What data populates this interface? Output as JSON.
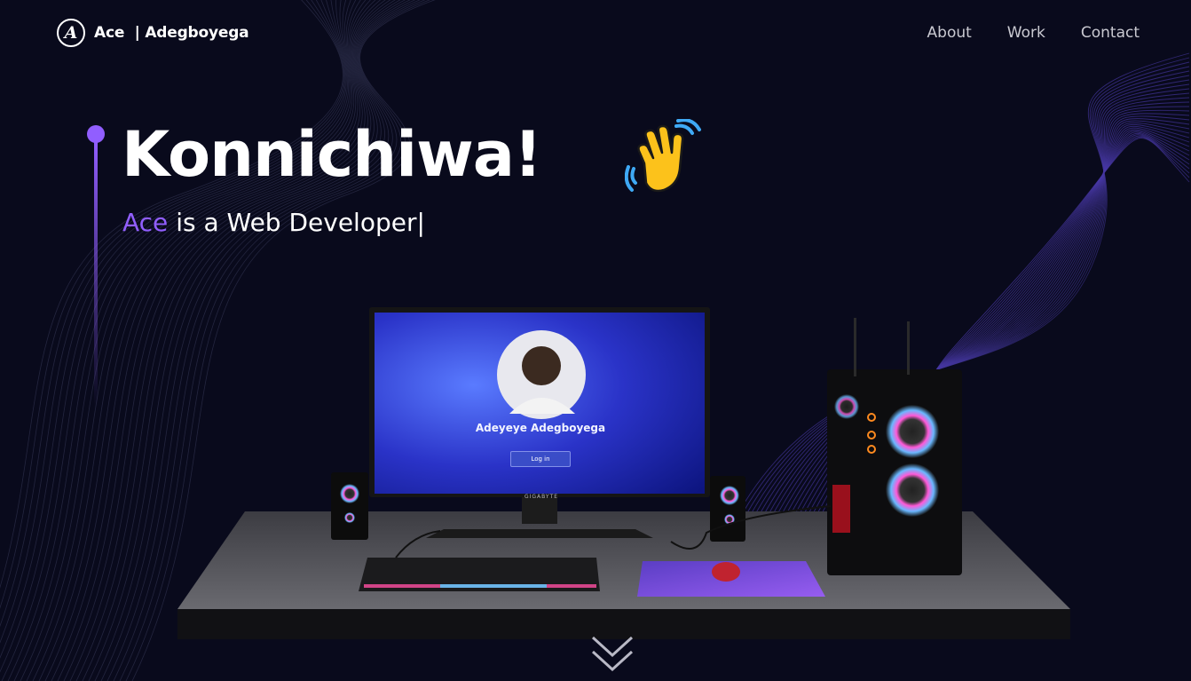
{
  "nav": {
    "logo_mark": "A",
    "logo_text": "Ace  | Adegboyega",
    "links": [
      "About",
      "Work",
      "Contact"
    ]
  },
  "hero": {
    "title": "Konnichiwa!",
    "subtitle_accent": "Ace",
    "subtitle_rest": " is a Web Developer|"
  },
  "monitor": {
    "user_name": "Adeyeye Adegboyega",
    "login_label": "Log in",
    "brand": "GIGABYTE"
  },
  "icons": {
    "logo": "signature-logo-icon",
    "wave": "waving-hand-icon",
    "scroll": "double-chevron-down-icon"
  },
  "colors": {
    "background": "#090a1c",
    "accent": "#915eff",
    "nav_text": "#c9c9d1"
  }
}
